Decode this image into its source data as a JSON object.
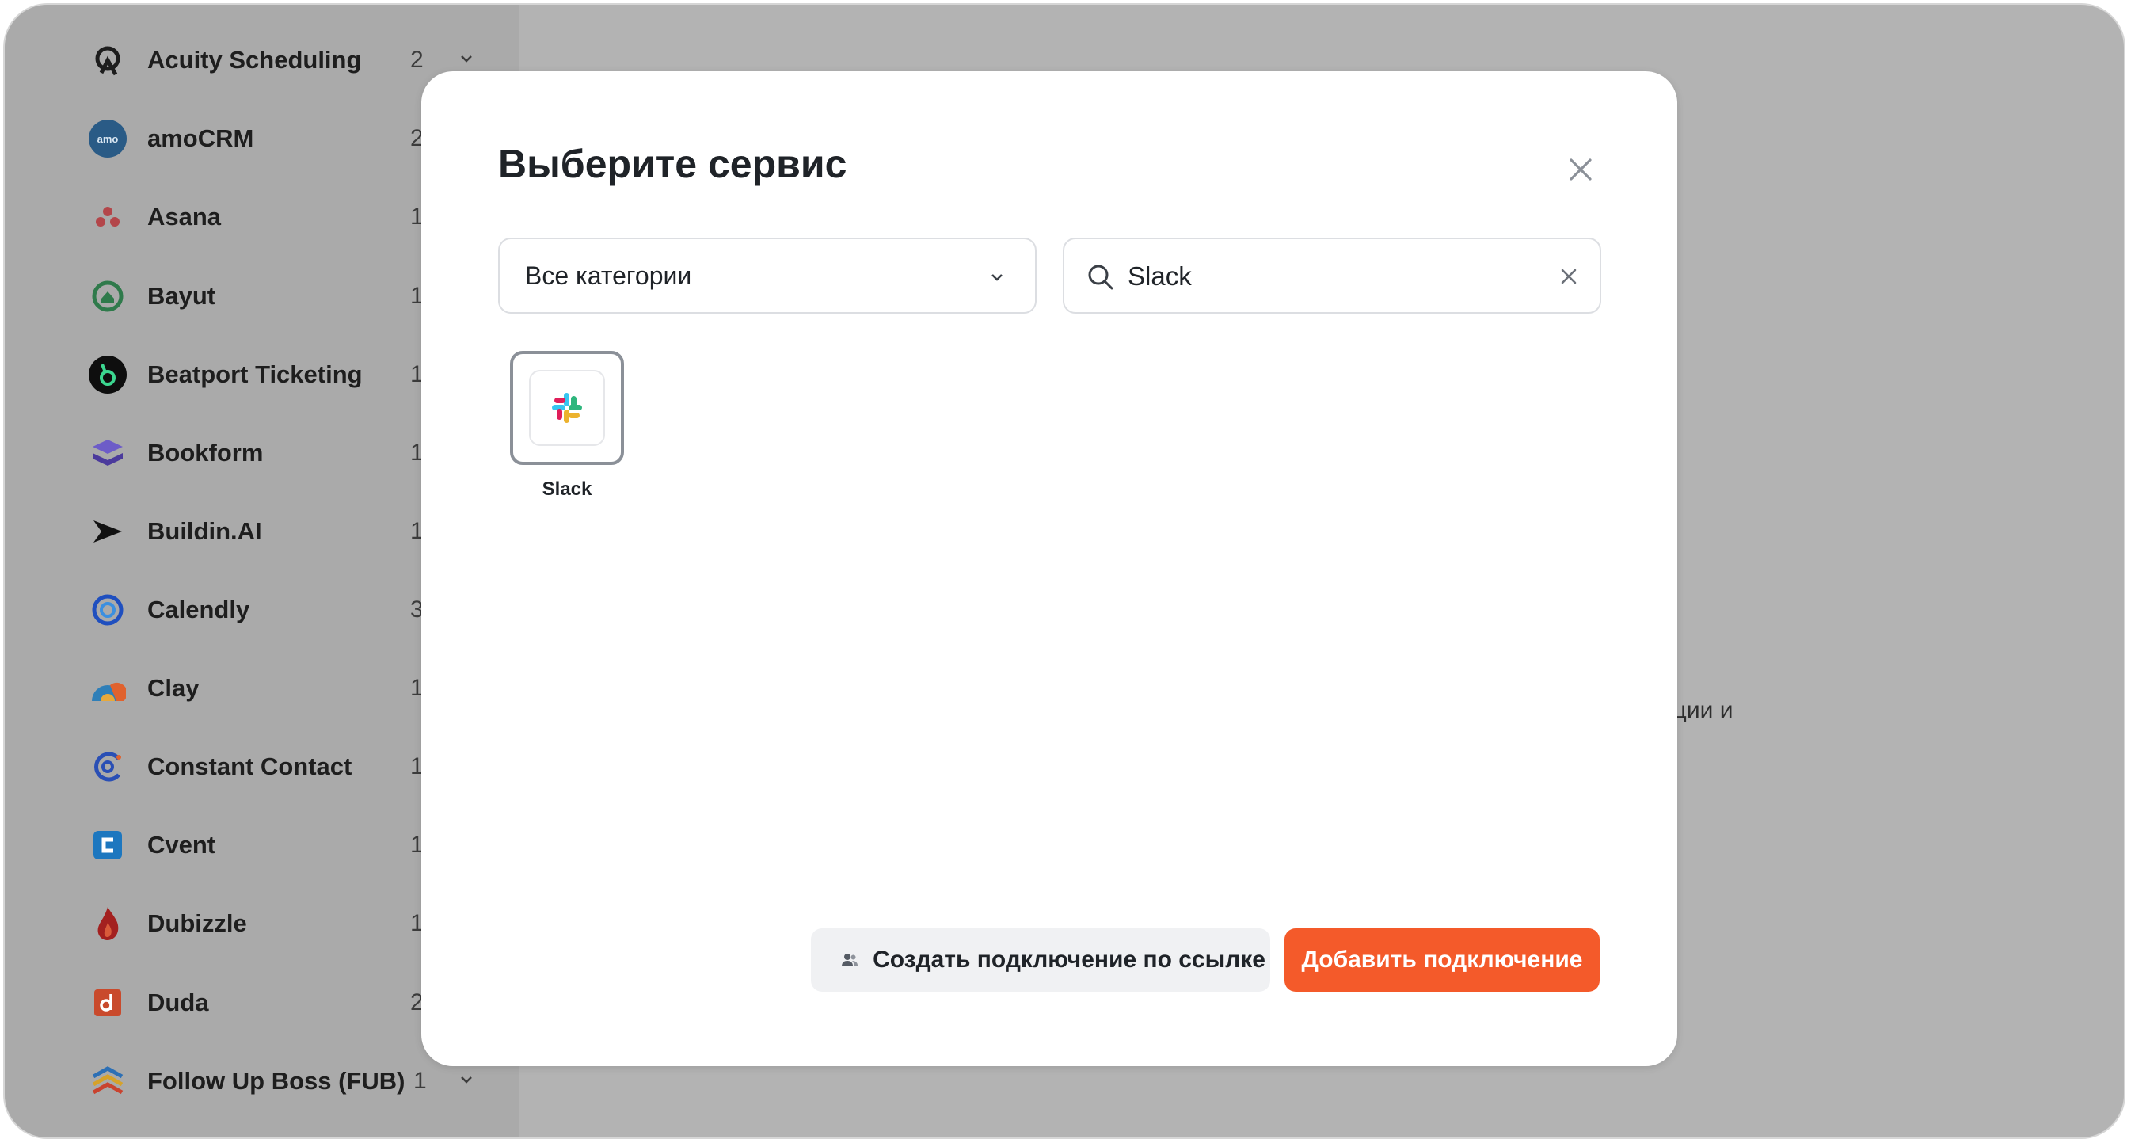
{
  "sidebar": {
    "items": [
      {
        "label": "Acuity Scheduling",
        "count": "2",
        "icon": "acuity-icon",
        "has_chevron": true
      },
      {
        "label": "amoCRM",
        "count": "2",
        "icon": "amocrm-icon"
      },
      {
        "label": "Asana",
        "count": "1",
        "icon": "asana-icon"
      },
      {
        "label": "Bayut",
        "count": "1",
        "icon": "bayut-icon"
      },
      {
        "label": "Beatport Ticketing",
        "count": "1",
        "icon": "beatport-icon"
      },
      {
        "label": "Bookform",
        "count": "1",
        "icon": "bookform-icon"
      },
      {
        "label": "Buildin.AI",
        "count": "1",
        "icon": "buildin-icon"
      },
      {
        "label": "Calendly",
        "count": "3",
        "icon": "calendly-icon"
      },
      {
        "label": "Clay",
        "count": "1",
        "icon": "clay-icon"
      },
      {
        "label": "Constant Contact",
        "count": "1",
        "icon": "constant-contact-icon"
      },
      {
        "label": "Cvent",
        "count": "1",
        "icon": "cvent-icon"
      },
      {
        "label": "Dubizzle",
        "count": "1",
        "icon": "dubizzle-icon"
      },
      {
        "label": "Duda",
        "count": "2",
        "icon": "duda-icon"
      },
      {
        "label": "Follow Up Boss (FUB)",
        "count": "1",
        "icon": "fub-icon",
        "has_chevron": true
      }
    ],
    "amocrm_icon_text": "amo"
  },
  "background": {
    "partial_text": "ации и"
  },
  "modal": {
    "title": "Выберите сервис",
    "category_select": {
      "value": "Все категории"
    },
    "search": {
      "value": "Slack"
    },
    "results": [
      {
        "label": "Slack",
        "icon": "slack-icon"
      }
    ],
    "create_link_button": "Создать подключение по ссылке",
    "add_button": "Добавить подключение"
  },
  "colors": {
    "accent": "#f45a2a",
    "overlay": "#b3b3b3",
    "sidebar_bg": "#aaaaaa"
  }
}
